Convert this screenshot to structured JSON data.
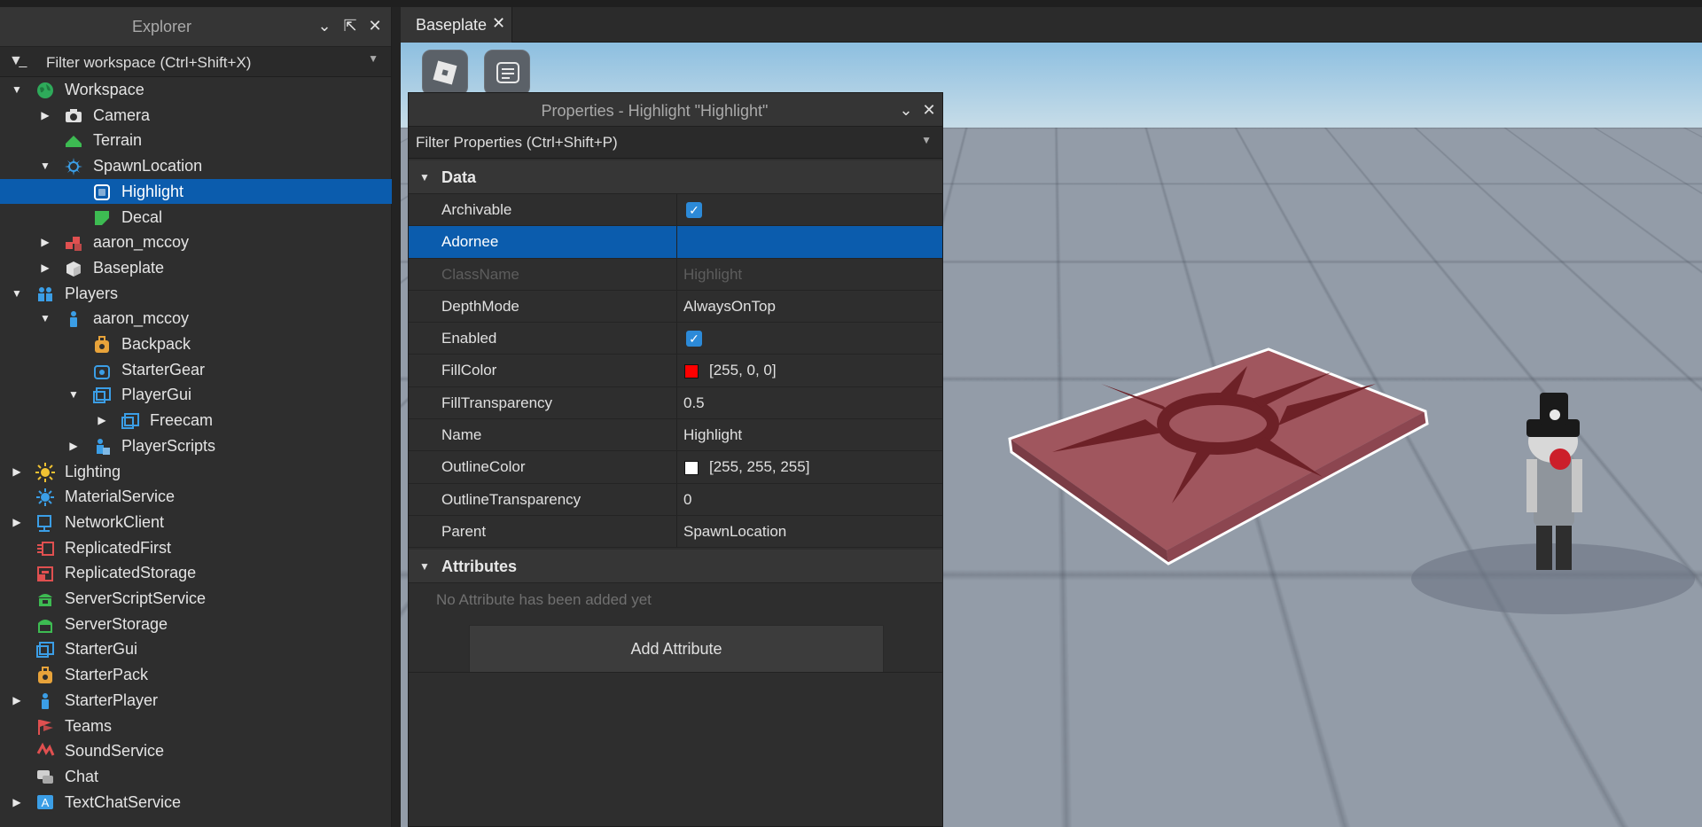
{
  "explorer": {
    "title": "Explorer",
    "filter_placeholder": "Filter workspace (Ctrl+Shift+X)",
    "items": [
      {
        "label": "Workspace",
        "depth": 0,
        "arrow": "down",
        "icon": "globe-icon",
        "color": "#2eaa5a"
      },
      {
        "label": "Camera",
        "depth": 1,
        "arrow": "right",
        "icon": "camera-icon",
        "color": "#e0e0e0"
      },
      {
        "label": "Terrain",
        "depth": 1,
        "arrow": "",
        "icon": "terrain-icon",
        "color": "#3dbb52"
      },
      {
        "label": "SpawnLocation",
        "depth": 1,
        "arrow": "down",
        "icon": "spawn-icon",
        "color": "#3b9ee6"
      },
      {
        "label": "Highlight",
        "depth": 2,
        "arrow": "",
        "icon": "highlight-icon",
        "color": "#ffffff",
        "selected": true
      },
      {
        "label": "Decal",
        "depth": 2,
        "arrow": "",
        "icon": "decal-icon",
        "color": "#3dbb52"
      },
      {
        "label": "aaron_mccoy",
        "depth": 1,
        "arrow": "right",
        "icon": "model-icon",
        "color": "#e05050"
      },
      {
        "label": "Baseplate",
        "depth": 1,
        "arrow": "right",
        "icon": "part-icon",
        "color": "#e0e0e0"
      },
      {
        "label": "Players",
        "depth": 0,
        "arrow": "down",
        "icon": "players-icon",
        "color": "#3b9ee6"
      },
      {
        "label": "aaron_mccoy",
        "depth": 1,
        "arrow": "down",
        "icon": "player-icon",
        "color": "#3b9ee6"
      },
      {
        "label": "Backpack",
        "depth": 2,
        "arrow": "",
        "icon": "backpack-icon",
        "color": "#e8a33a"
      },
      {
        "label": "StarterGear",
        "depth": 2,
        "arrow": "",
        "icon": "startergear-icon",
        "color": "#3b9ee6"
      },
      {
        "label": "PlayerGui",
        "depth": 2,
        "arrow": "down",
        "icon": "playergui-icon",
        "color": "#3b9ee6"
      },
      {
        "label": "Freecam",
        "depth": 3,
        "arrow": "right",
        "icon": "screengui-icon",
        "color": "#3b9ee6"
      },
      {
        "label": "PlayerScripts",
        "depth": 2,
        "arrow": "right",
        "icon": "playerscripts-icon",
        "color": "#3b9ee6"
      },
      {
        "label": "Lighting",
        "depth": 0,
        "arrow": "right",
        "icon": "lighting-icon",
        "color": "#f1c232"
      },
      {
        "label": "MaterialService",
        "depth": 0,
        "arrow": "",
        "icon": "materialservice-icon",
        "color": "#3b9ee6"
      },
      {
        "label": "NetworkClient",
        "depth": 0,
        "arrow": "right",
        "icon": "networkclient-icon",
        "color": "#3b9ee6"
      },
      {
        "label": "ReplicatedFirst",
        "depth": 0,
        "arrow": "",
        "icon": "replicatedfirst-icon",
        "color": "#e05050"
      },
      {
        "label": "ReplicatedStorage",
        "depth": 0,
        "arrow": "",
        "icon": "replicatedstorage-icon",
        "color": "#e05050"
      },
      {
        "label": "ServerScriptService",
        "depth": 0,
        "arrow": "",
        "icon": "serverscriptservice-icon",
        "color": "#3dbb52"
      },
      {
        "label": "ServerStorage",
        "depth": 0,
        "arrow": "",
        "icon": "serverstorage-icon",
        "color": "#3dbb52"
      },
      {
        "label": "StarterGui",
        "depth": 0,
        "arrow": "",
        "icon": "startergui-icon",
        "color": "#3b9ee6"
      },
      {
        "label": "StarterPack",
        "depth": 0,
        "arrow": "",
        "icon": "starterpack-icon",
        "color": "#e8a33a"
      },
      {
        "label": "StarterPlayer",
        "depth": 0,
        "arrow": "right",
        "icon": "starterplayer-icon",
        "color": "#3b9ee6"
      },
      {
        "label": "Teams",
        "depth": 0,
        "arrow": "",
        "icon": "teams-icon",
        "color": "#e05050"
      },
      {
        "label": "SoundService",
        "depth": 0,
        "arrow": "",
        "icon": "soundservice-icon",
        "color": "#e05050"
      },
      {
        "label": "Chat",
        "depth": 0,
        "arrow": "",
        "icon": "chat-icon",
        "color": "#d0d0d0"
      },
      {
        "label": "TextChatService",
        "depth": 0,
        "arrow": "right",
        "icon": "textchatservice-icon",
        "color": "#3b9ee6"
      }
    ]
  },
  "tab": {
    "label": "Baseplate"
  },
  "properties": {
    "title": "Properties - Highlight \"Highlight\"",
    "filter_placeholder": "Filter Properties (Ctrl+Shift+P)",
    "sections": {
      "data": "Data",
      "attributes": "Attributes"
    },
    "rows": [
      {
        "name": "Archivable",
        "kind": "check",
        "value": ""
      },
      {
        "name": "Adornee",
        "kind": "text",
        "value": "",
        "selected": true
      },
      {
        "name": "ClassName",
        "kind": "text",
        "value": "Highlight",
        "readonly": true
      },
      {
        "name": "DepthMode",
        "kind": "text",
        "value": "AlwaysOnTop"
      },
      {
        "name": "Enabled",
        "kind": "check",
        "value": ""
      },
      {
        "name": "FillColor",
        "kind": "color",
        "value": "[255, 0, 0]",
        "swatch": "#ff0000"
      },
      {
        "name": "FillTransparency",
        "kind": "text",
        "value": "0.5"
      },
      {
        "name": "Name",
        "kind": "text",
        "value": "Highlight"
      },
      {
        "name": "OutlineColor",
        "kind": "color",
        "value": "[255, 255, 255]",
        "swatch": "#ffffff"
      },
      {
        "name": "OutlineTransparency",
        "kind": "text",
        "value": "0"
      },
      {
        "name": "Parent",
        "kind": "text",
        "value": "SpawnLocation"
      }
    ],
    "no_attributes_text": "No Attribute has been added yet",
    "add_attribute_label": "Add Attribute"
  },
  "colors": {
    "selection": "#0b5cad",
    "checkbox": "#2c8ad8",
    "spawn_fill": "#a0565e",
    "outline": "#ffffff"
  }
}
